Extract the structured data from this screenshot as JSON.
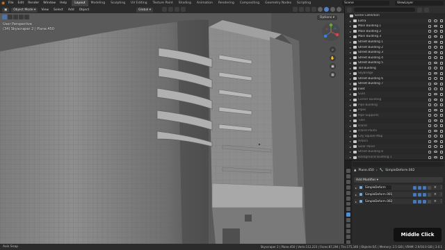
{
  "topbar": {
    "menus": [
      "File",
      "Edit",
      "Render",
      "Window",
      "Help"
    ],
    "workspaces": [
      "Layout",
      "Modeling",
      "Sculpting",
      "UV Editing",
      "Texture Paint",
      "Shading",
      "Animation",
      "Rendering",
      "Compositing",
      "Geometry Nodes",
      "Scripting"
    ],
    "active_workspace": "Layout",
    "scene": "Scene",
    "view_layer": "ViewLayer"
  },
  "viewport": {
    "mode": "Object Mode",
    "menus": [
      "View",
      "Select",
      "Add",
      "Object"
    ],
    "transform_orientation": "Global",
    "options_label": "Options",
    "info_line1": "User Perspective",
    "info_line2": "(34) Skyscraper 2 | Plane.450"
  },
  "outliner": {
    "search_placeholder": "",
    "rows": [
      {
        "name": "Scene Collection",
        "type": "scene",
        "dim": false,
        "indent": 0
      },
      {
        "name": "Extra",
        "type": "collection",
        "dim": false,
        "indent": 1
      },
      {
        "name": "Main Building 1",
        "type": "collection",
        "dim": false,
        "indent": 1
      },
      {
        "name": "Main Building 2",
        "type": "collection",
        "dim": false,
        "indent": 1
      },
      {
        "name": "Main Building 3",
        "type": "collection",
        "dim": false,
        "indent": 1
      },
      {
        "name": "Street Building 1",
        "type": "collection",
        "dim": false,
        "indent": 1
      },
      {
        "name": "Street Building 2",
        "type": "collection",
        "dim": false,
        "indent": 1
      },
      {
        "name": "Street Building 3",
        "type": "collection",
        "dim": false,
        "indent": 1
      },
      {
        "name": "Street Building 4",
        "type": "collection",
        "dim": false,
        "indent": 1
      },
      {
        "name": "Street Building 5",
        "type": "collection",
        "dim": false,
        "indent": 1
      },
      {
        "name": "Tall Building",
        "type": "collection",
        "dim": false,
        "indent": 1
      },
      {
        "name": "Skybridge",
        "type": "collection",
        "dim": true,
        "indent": 1
      },
      {
        "name": "Street Building 6",
        "type": "collection",
        "dim": false,
        "indent": 1
      },
      {
        "name": "Street Building 7",
        "type": "collection",
        "dim": false,
        "indent": 1
      },
      {
        "name": "Inlet",
        "type": "collection",
        "dim": false,
        "indent": 1
      },
      {
        "name": "Gold",
        "type": "collection",
        "dim": true,
        "indent": 1
      },
      {
        "name": "Corner Building",
        "type": "collection",
        "dim": true,
        "indent": 1
      },
      {
        "name": "Pipe Building",
        "type": "collection",
        "dim": true,
        "indent": 1
      },
      {
        "name": "Pipes",
        "type": "collection",
        "dim": true,
        "indent": 1
      },
      {
        "name": "Pipe Supports",
        "type": "collection",
        "dim": true,
        "indent": 1
      },
      {
        "name": "Tiles",
        "type": "collection",
        "dim": true,
        "indent": 1
      },
      {
        "name": "Island",
        "type": "collection",
        "dim": true,
        "indent": 1
      },
      {
        "name": "Island Plants",
        "type": "collection",
        "dim": true,
        "indent": 1
      },
      {
        "name": "City Square Map",
        "type": "collection",
        "dim": true,
        "indent": 1
      },
      {
        "name": "Arbors",
        "type": "collection",
        "dim": true,
        "indent": 1
      },
      {
        "name": "Solar Panel",
        "type": "collection",
        "dim": true,
        "indent": 1
      },
      {
        "name": "Street Building 8",
        "type": "collection",
        "dim": true,
        "indent": 1
      },
      {
        "name": "Background Building 1",
        "type": "collection",
        "dim": true,
        "indent": 1
      }
    ]
  },
  "properties": {
    "object_name": "Plane.450",
    "modifier_breadcrumb": "SimpleDeform.002",
    "add_modifier_label": "Add Modifier",
    "modifiers": [
      "SimpleDeform",
      "SimpleDeform.001",
      "SimpleDeform.002"
    ]
  },
  "statusbar": {
    "left": "Axis Snap",
    "right": "Skyscraper 2 | Plane.450 | Verts:112,223 | Faces:87,294 | Tris:175,346 | Objects:0/1 | Memory: 2.5 GiB | VRAM: 2.9/16.0 GiB | 3.0.1"
  },
  "overlay": {
    "label": "Middle Click"
  },
  "colors": {
    "accent": "#4772b3",
    "brand": "#e87d0d",
    "viewport_bg": "#5b5b5b"
  }
}
